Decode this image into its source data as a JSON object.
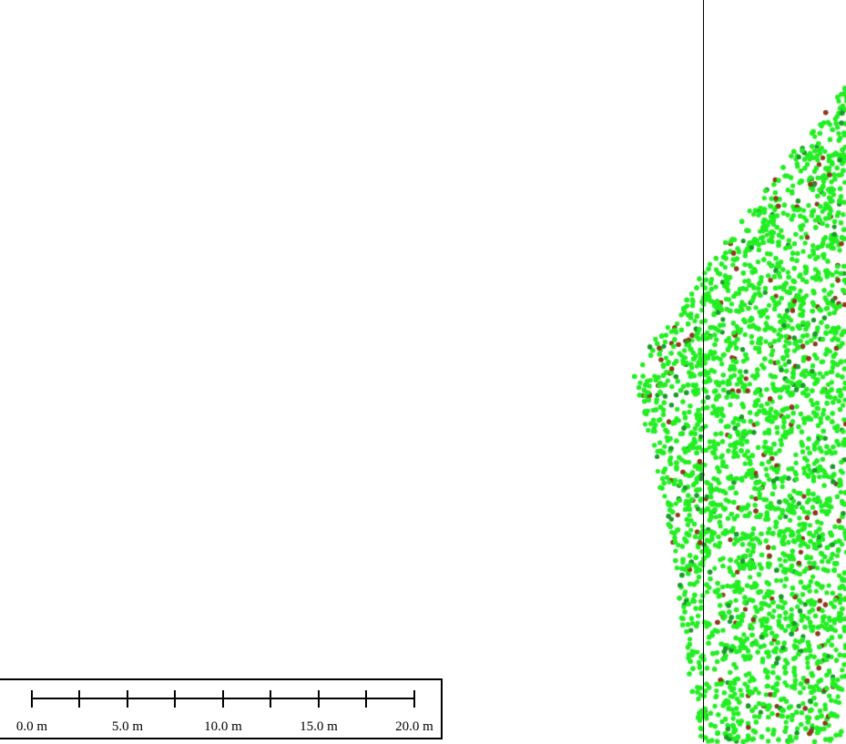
{
  "map": {
    "background_color": "#ffffff",
    "point_colors": {
      "vegetation_light": "#22ee22",
      "vegetation_dark": "#199a2a",
      "ground_brown": "#8b3a1a"
    }
  },
  "scale_bar": {
    "unit": "m",
    "labels": [
      "0.0 m",
      "5.0 m",
      "10.0 m",
      "15.0 m",
      "20.0 m"
    ]
  }
}
